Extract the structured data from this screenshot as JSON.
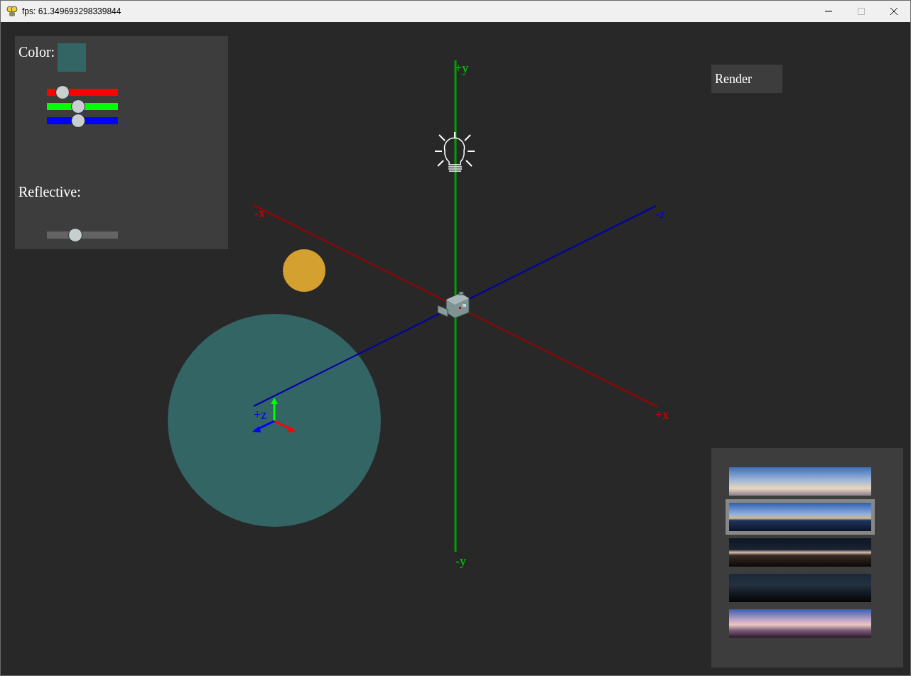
{
  "window": {
    "title": "fps: 61.349693298339844"
  },
  "material_panel": {
    "color_label": "Color:",
    "color_sliders": [
      {
        "kind": "red",
        "level": 0.22
      },
      {
        "kind": "green",
        "level": 0.44
      },
      {
        "kind": "blue",
        "level": 0.44
      }
    ],
    "reflective_label": "Reflective:",
    "reflective_slider": {
      "level": 0.4
    }
  },
  "render_button": {
    "label": "Render"
  },
  "scene": {
    "axis_labels": [
      {
        "text": "+y",
        "color": "#00d000"
      },
      {
        "text": "-x",
        "color": "#dd0000"
      },
      {
        "text": "-z",
        "color": "#0000dd"
      },
      {
        "text": "+x",
        "color": "#dd0000"
      },
      {
        "text": "+z",
        "color": "#0000dd"
      },
      {
        "text": "-y",
        "color": "#00d000"
      }
    ]
  },
  "skybox_panel": {
    "items": [
      {
        "selected": false
      },
      {
        "selected": true
      },
      {
        "selected": false
      },
      {
        "selected": false
      },
      {
        "selected": false
      }
    ]
  }
}
